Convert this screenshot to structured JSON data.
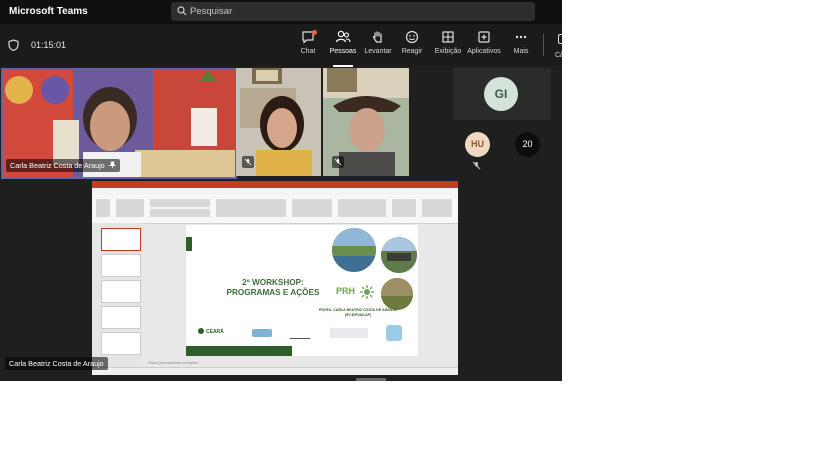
{
  "app": {
    "title": "Microsoft Teams"
  },
  "search": {
    "placeholder": "Pesquisar"
  },
  "meeting": {
    "timer": "01:15:01"
  },
  "toolbar": {
    "chat": "Chat",
    "people": "Pessoas",
    "raise": "Levantar",
    "react": "Reagir",
    "view": "Exibição",
    "apps": "Aplicativos",
    "more": "Mais",
    "camera_cut": "Câ"
  },
  "participants": {
    "speaker_name": "Carla Beatriz Costa de Araujo",
    "gi_initials": "GI",
    "hu_initials": "HU",
    "more_count": "20"
  },
  "share": {
    "presenter_name": "Carla Beatriz Costa de Araujo",
    "slide": {
      "heading_line1": "2º WORKSHOP:",
      "heading_line2": "PROGRAMAS E AÇÕES",
      "brand": "PRH",
      "professor": "PROFA. CARLA BEATRIZ COSTA DE ARAÚJO",
      "institution": "(IFCE/FUNCAP)",
      "logo_ceara": "CEARÁ"
    },
    "notes_placeholder": "Clique para adicionar anotações"
  },
  "colors": {
    "accent": "#6264a7",
    "slide_green": "#3c6f3a",
    "ppt_red": "#c43e1c"
  }
}
